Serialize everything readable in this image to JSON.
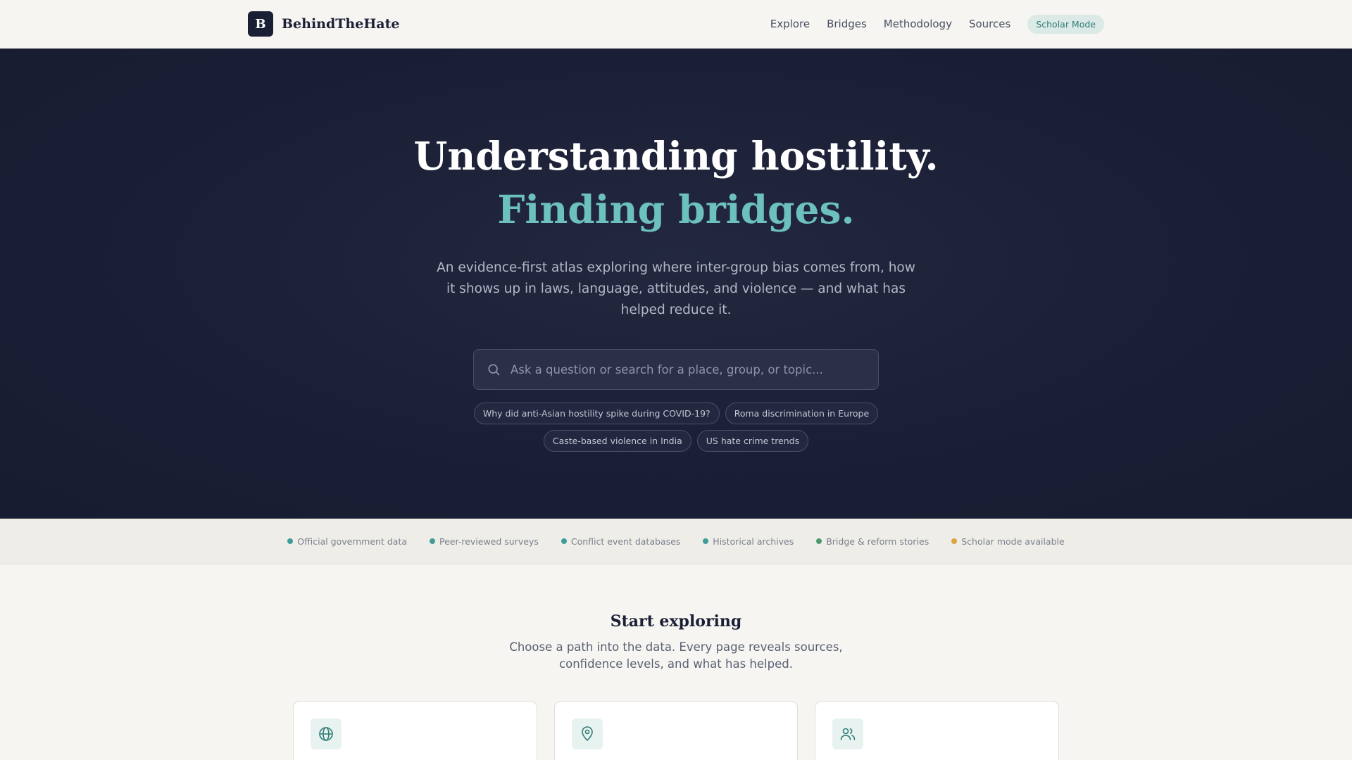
{
  "brand": {
    "logo_letter": "B",
    "name": "BehindTheHate"
  },
  "nav": {
    "items": [
      "Explore",
      "Bridges",
      "Methodology",
      "Sources"
    ],
    "scholar_mode": "Scholar Mode"
  },
  "hero": {
    "title_main": "Understanding hostility.",
    "title_accent": "Finding bridges.",
    "lead": "An evidence-first atlas exploring where inter-group bias comes from, how it shows up in laws, language, attitudes, and violence — and what has helped reduce it.",
    "search_placeholder": "Ask a question or search for a place, group, or topic...",
    "suggestions": [
      "Why did anti-Asian hostility spike during COVID-19?",
      "Roma discrimination in Europe",
      "Caste-based violence in India",
      "US hate crime trends"
    ]
  },
  "sources_strip": [
    {
      "label": "Official government data",
      "color": "#3f9d97"
    },
    {
      "label": "Peer-reviewed surveys",
      "color": "#3f9d97"
    },
    {
      "label": "Conflict event databases",
      "color": "#3f9d97"
    },
    {
      "label": "Historical archives",
      "color": "#3f9d97"
    },
    {
      "label": "Bridge & reform stories",
      "color": "#4a9a6c"
    },
    {
      "label": "Scholar mode available",
      "color": "#d6a53c"
    }
  ],
  "explore": {
    "title": "Start exploring",
    "subtitle": "Choose a path into the data. Every page reveals sources, confidence levels, and what has helped.",
    "cards": [
      {
        "icon": "globe-icon"
      },
      {
        "icon": "map-pin-icon"
      },
      {
        "icon": "users-icon"
      }
    ]
  },
  "colors": {
    "navy": "#1b1f36",
    "teal_accent": "#6cc0be",
    "page_bg": "#f6f5f1"
  }
}
